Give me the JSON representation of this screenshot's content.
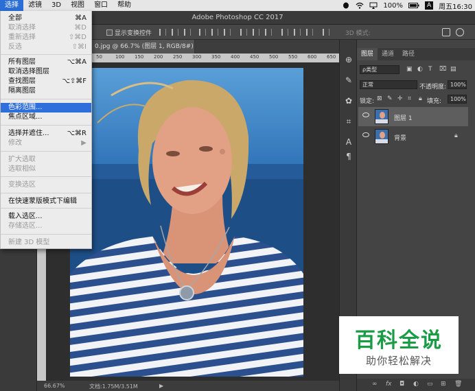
{
  "menubar": {
    "items": [
      "选择",
      "滤镜",
      "3D",
      "视图",
      "窗口",
      "帮助"
    ],
    "battery": "100%",
    "input_method": "A",
    "clock": "周五16:30"
  },
  "window_title": "Adobe Photoshop CC 2017",
  "options_bar": {
    "show_transform_label": "显示变换控件",
    "mode_3d_label": "3D 模式:"
  },
  "document": {
    "tab_title": "0.jpg @ 66.7% (图层 1, RGB/8#) *",
    "ruler_ticks": [
      "50",
      "100",
      "150",
      "200",
      "250",
      "300",
      "350",
      "400",
      "450",
      "500",
      "550",
      "600",
      "650"
    ],
    "zoom": "66.67%",
    "doc_size": "文档:1.75M/3.51M"
  },
  "select_menu": {
    "items": [
      {
        "label": "全部",
        "shortcut": "⌘A",
        "disabled": false
      },
      {
        "label": "取消选择",
        "shortcut": "⌘D",
        "disabled": true
      },
      {
        "label": "重新选择",
        "shortcut": "⇧⌘D",
        "disabled": true
      },
      {
        "label": "反选",
        "shortcut": "⇧⌘I",
        "disabled": true
      },
      {
        "label": "所有图层",
        "shortcut": "⌥⌘A",
        "disabled": false
      },
      {
        "label": "取消选择图层",
        "shortcut": "",
        "disabled": false
      },
      {
        "label": "查找图层",
        "shortcut": "⌥⇧⌘F",
        "disabled": false
      },
      {
        "label": "隔离图层",
        "shortcut": "",
        "disabled": false
      },
      {
        "label": "色彩范围...",
        "shortcut": "",
        "disabled": false,
        "highlighted": true
      },
      {
        "label": "焦点区域...",
        "shortcut": "",
        "disabled": false
      },
      {
        "label": "选择并遮住...",
        "shortcut": "⌥⌘R",
        "disabled": false
      },
      {
        "label": "修改",
        "shortcut": "▶",
        "disabled": true
      },
      {
        "label": "扩大选取",
        "shortcut": "",
        "disabled": true
      },
      {
        "label": "选取相似",
        "shortcut": "",
        "disabled": true
      },
      {
        "label": "变换选区",
        "shortcut": "",
        "disabled": true
      },
      {
        "label": "在快速蒙版模式下编辑",
        "shortcut": "",
        "disabled": false
      },
      {
        "label": "载入选区...",
        "shortcut": "",
        "disabled": false
      },
      {
        "label": "存储选区...",
        "shortcut": "",
        "disabled": true
      },
      {
        "label": "新建 3D 模型",
        "shortcut": "",
        "disabled": true
      }
    ]
  },
  "layers_panel": {
    "tabs": [
      "图层",
      "通道",
      "路径"
    ],
    "filter_kind": "ρ类型",
    "blend_mode": "正常",
    "opacity_label": "不透明度:",
    "opacity_value": "100%",
    "lock_label": "锁定:",
    "fill_label": "填充:",
    "fill_value": "100%",
    "layers": [
      {
        "name": "图层 1",
        "selected": true,
        "locked": false
      },
      {
        "name": "背景",
        "selected": false,
        "locked": true
      }
    ],
    "footer_fx": "fx"
  },
  "watermark": {
    "title": "百科全说",
    "subtitle": "助你轻松解决"
  },
  "colors": {
    "menu_highlight": "#2f6fdb",
    "watermark_green": "#1a9b46"
  }
}
